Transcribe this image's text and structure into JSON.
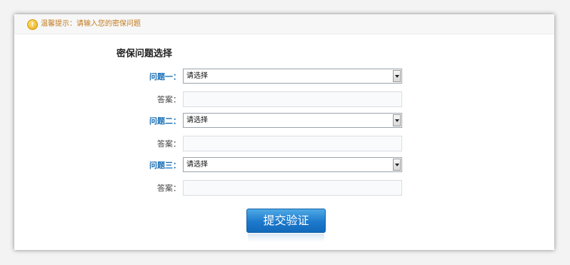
{
  "tip": {
    "icon": "info-icon",
    "text": "温馨提示：请输入您的密保问题"
  },
  "section_title": "密保问题选择",
  "questions": [
    {
      "label": "问题一：",
      "selected": "请选择",
      "answer_label": "答案：",
      "answer_value": ""
    },
    {
      "label": "问题二：",
      "selected": "请选择",
      "answer_label": "答案：",
      "answer_value": ""
    },
    {
      "label": "问题三：",
      "selected": "请选择",
      "answer_label": "答案：",
      "answer_value": ""
    }
  ],
  "submit_label": "提交验证",
  "colors": {
    "question_label": "#1a6fb5",
    "tip_text": "#c07a1c",
    "button": "#1d79cc"
  }
}
